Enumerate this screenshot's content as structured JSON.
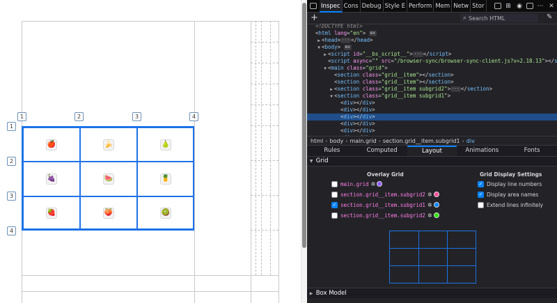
{
  "viewport": {
    "line_numbers": {
      "cols": [
        "1",
        "2",
        "3",
        "4"
      ],
      "rows": [
        "1",
        "2",
        "3",
        "4"
      ]
    },
    "cells": [
      {
        "fruit": "apple-icon",
        "glyph": "🍎",
        "color": "#d4001a"
      },
      {
        "fruit": "banana-icon",
        "glyph": "🍌",
        "color": "#e7c400"
      },
      {
        "fruit": "pear-icon",
        "glyph": "🍐",
        "color": "#9bbd25"
      },
      {
        "fruit": "grapes-icon",
        "glyph": "🍇",
        "color": "#7a2c8c"
      },
      {
        "fruit": "watermelon-icon",
        "glyph": "🍉",
        "color": "#e8454c"
      },
      {
        "fruit": "pineapple-icon",
        "glyph": "🍍",
        "color": "#d89a1c"
      },
      {
        "fruit": "strawberry-icon",
        "glyph": "🍓",
        "color": "#d81f26"
      },
      {
        "fruit": "peach-icon",
        "glyph": "🍑",
        "color": "#f08a4a"
      },
      {
        "fruit": "kiwi-icon",
        "glyph": "🥝",
        "color": "#6d9a23"
      }
    ],
    "grid_color": "#1c72e8"
  },
  "devtools": {
    "tabs": [
      {
        "label": "Inspector",
        "short": "Inspec",
        "active": true
      },
      {
        "label": "Console",
        "short": "Cons",
        "active": false
      },
      {
        "label": "Debugger",
        "short": "Debug",
        "active": false
      },
      {
        "label": "Style Editor",
        "short": "Style E",
        "active": false
      },
      {
        "label": "Performance",
        "short": "Perform",
        "active": false
      },
      {
        "label": "Memory",
        "short": "Mem",
        "active": false
      },
      {
        "label": "Network",
        "short": "Netw",
        "active": false
      },
      {
        "label": "Storage",
        "short": "Stor",
        "active": false
      }
    ],
    "search_placeholder": "Search HTML",
    "markup": [
      {
        "indent": 0,
        "twisty": "",
        "parts": [
          [
            "d",
            "<!DOCTYPE html>"
          ]
        ],
        "selected": false
      },
      {
        "indent": 0,
        "twisty": "",
        "parts": [
          [
            "x",
            "<"
          ],
          [
            "t",
            "html"
          ],
          [
            "a",
            " lang"
          ],
          [
            "x",
            "="
          ],
          [
            "v",
            "\"en\""
          ],
          [
            "x",
            ">"
          ]
        ],
        "pill": "ev",
        "selected": false
      },
      {
        "indent": 1,
        "twisty": "▶",
        "parts": [
          [
            "x",
            "<"
          ],
          [
            "t",
            "head"
          ],
          [
            "x",
            ">"
          ],
          [
            "pill",
            "···"
          ],
          [
            "x",
            "</"
          ],
          [
            "t",
            "head"
          ],
          [
            "x",
            ">"
          ]
        ],
        "selected": false
      },
      {
        "indent": 1,
        "twisty": "▼",
        "parts": [
          [
            "x",
            "<"
          ],
          [
            "t",
            "body"
          ],
          [
            "x",
            ">"
          ]
        ],
        "pill": "ev",
        "selected": false
      },
      {
        "indent": 2,
        "twisty": "▶",
        "parts": [
          [
            "x",
            "<"
          ],
          [
            "t",
            "script"
          ],
          [
            "a",
            " id"
          ],
          [
            "x",
            "="
          ],
          [
            "v",
            "\"__bs_script__\""
          ],
          [
            "x",
            ">"
          ],
          [
            "pill",
            "···"
          ],
          [
            "x",
            "</"
          ],
          [
            "t",
            "script"
          ],
          [
            "x",
            ">"
          ]
        ],
        "selected": false
      },
      {
        "indent": 2,
        "twisty": "",
        "parts": [
          [
            "x",
            "<"
          ],
          [
            "t",
            "script"
          ],
          [
            "a",
            " async"
          ],
          [
            "x",
            "="
          ],
          [
            "v",
            "\"\""
          ],
          [
            "a",
            " src"
          ],
          [
            "x",
            "="
          ],
          [
            "v",
            "\"/browser-sync/browser-sync-client.js?v=2.18.13\""
          ],
          [
            "x",
            "></"
          ],
          [
            "t",
            "script"
          ],
          [
            "x",
            ">"
          ]
        ],
        "selected": false
      },
      {
        "indent": 2,
        "twisty": "▼",
        "parts": [
          [
            "x",
            "<"
          ],
          [
            "t",
            "main"
          ],
          [
            "a",
            " class"
          ],
          [
            "x",
            "="
          ],
          [
            "v",
            "\"grid\""
          ],
          [
            "x",
            ">"
          ]
        ],
        "selected": false
      },
      {
        "indent": 3,
        "twisty": "",
        "parts": [
          [
            "x",
            "<"
          ],
          [
            "t",
            "section"
          ],
          [
            "a",
            " class"
          ],
          [
            "x",
            "="
          ],
          [
            "v",
            "\"grid__item\""
          ],
          [
            "x",
            "></"
          ],
          [
            "t",
            "section"
          ],
          [
            "x",
            ">"
          ]
        ],
        "selected": false
      },
      {
        "indent": 3,
        "twisty": "",
        "parts": [
          [
            "x",
            "<"
          ],
          [
            "t",
            "section"
          ],
          [
            "a",
            " class"
          ],
          [
            "x",
            "="
          ],
          [
            "v",
            "\"grid__item\""
          ],
          [
            "x",
            "></"
          ],
          [
            "t",
            "section"
          ],
          [
            "x",
            ">"
          ]
        ],
        "selected": false
      },
      {
        "indent": 3,
        "twisty": "▶",
        "parts": [
          [
            "x",
            "<"
          ],
          [
            "t",
            "section"
          ],
          [
            "a",
            " class"
          ],
          [
            "x",
            "="
          ],
          [
            "v",
            "\"grid__item subgrid2\""
          ],
          [
            "x",
            ">"
          ],
          [
            "pill",
            "···"
          ],
          [
            "x",
            "</"
          ],
          [
            "t",
            "section"
          ],
          [
            "x",
            ">"
          ]
        ],
        "selected": false
      },
      {
        "indent": 3,
        "twisty": "▼",
        "parts": [
          [
            "x",
            "<"
          ],
          [
            "t",
            "section"
          ],
          [
            "a",
            " class"
          ],
          [
            "x",
            "="
          ],
          [
            "v",
            "\"grid__item subgrid1\""
          ],
          [
            "x",
            ">"
          ]
        ],
        "selected": false
      },
      {
        "indent": 4,
        "twisty": "",
        "parts": [
          [
            "x",
            "<"
          ],
          [
            "t",
            "div"
          ],
          [
            "x",
            "></"
          ],
          [
            "t",
            "div"
          ],
          [
            "x",
            ">"
          ]
        ],
        "selected": false
      },
      {
        "indent": 4,
        "twisty": "",
        "parts": [
          [
            "x",
            "<"
          ],
          [
            "t",
            "div"
          ],
          [
            "x",
            "></"
          ],
          [
            "t",
            "div"
          ],
          [
            "x",
            ">"
          ]
        ],
        "selected": false
      },
      {
        "indent": 4,
        "twisty": "",
        "parts": [
          [
            "x",
            "<"
          ],
          [
            "t",
            "div"
          ],
          [
            "x",
            "></"
          ],
          [
            "t",
            "div"
          ],
          [
            "x",
            ">"
          ]
        ],
        "selected": true
      },
      {
        "indent": 4,
        "twisty": "",
        "parts": [
          [
            "x",
            "<"
          ],
          [
            "t",
            "div"
          ],
          [
            "x",
            "></"
          ],
          [
            "t",
            "div"
          ],
          [
            "x",
            ">"
          ]
        ],
        "selected": false
      },
      {
        "indent": 4,
        "twisty": "",
        "parts": [
          [
            "x",
            "<"
          ],
          [
            "t",
            "div"
          ],
          [
            "x",
            "></"
          ],
          [
            "t",
            "div"
          ],
          [
            "x",
            ">"
          ]
        ],
        "selected": false
      },
      {
        "indent": 4,
        "twisty": "",
        "parts": [
          [
            "x",
            "<"
          ],
          [
            "t",
            "div"
          ],
          [
            "x",
            "></"
          ],
          [
            "t",
            "div"
          ],
          [
            "x",
            ">"
          ]
        ],
        "selected": false
      }
    ],
    "breadcrumbs": [
      {
        "label": "html",
        "current": false
      },
      {
        "label": "body",
        "current": false
      },
      {
        "label": "main.grid",
        "current": false
      },
      {
        "label": "section.grid__item.subgrid1",
        "current": false
      },
      {
        "label": "div",
        "current": true
      }
    ],
    "side_tabs": [
      {
        "label": "Rules",
        "active": false
      },
      {
        "label": "Computed",
        "active": false
      },
      {
        "label": "Layout",
        "active": true
      },
      {
        "label": "Animations",
        "active": false
      },
      {
        "label": "Fonts",
        "active": false
      }
    ],
    "grid_section_title": "Grid",
    "overlay_title": "Overlay Grid",
    "overlay_items": [
      {
        "label": "main.grid",
        "checked": false,
        "color": "#9059ff"
      },
      {
        "label": "section.grid__item.subgrid2",
        "checked": false,
        "color": "#ff4f9a"
      },
      {
        "label": "section.grid__item.subgrid1",
        "checked": true,
        "color": "#0a84ff"
      },
      {
        "label": "section.grid__item.subgrid2",
        "checked": false,
        "color": "#30e60b"
      }
    ],
    "settings_title": "Grid Display Settings",
    "settings_items": [
      {
        "label": "Display line numbers",
        "checked": true
      },
      {
        "label": "Display area names",
        "checked": true
      },
      {
        "label": "Extend lines infinitely",
        "checked": false
      }
    ],
    "box_model_title": "Box Model"
  }
}
